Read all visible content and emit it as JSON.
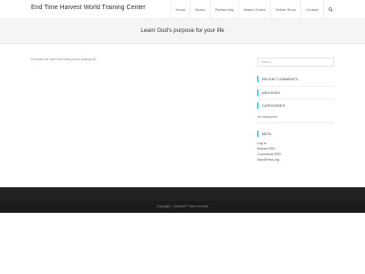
{
  "site": {
    "title": "End Time Harvest World Training Center"
  },
  "nav": {
    "items": [
      "Home",
      "Music",
      "Partnership",
      "Watch Online",
      "Online Store",
      "Contact"
    ],
    "search_icon": "search-icon"
  },
  "banner": {
    "title": "Learn God's purpose for your life"
  },
  "main": {
    "message": "It seems we can't find what you're looking for."
  },
  "sidebar": {
    "search_placeholder": "Search",
    "recent_comments": "RECENT COMMENTS",
    "archives": "ARCHIVES",
    "categories": "CATEGORIES",
    "no_categories": "No categories",
    "meta": "META",
    "meta_links": [
      "Log in",
      "Entries RSS",
      "Comments RSS",
      "WordPress.org"
    ]
  },
  "footer": {
    "copyright": "Copyright - OceanWP Theme by Nick"
  },
  "colors": {
    "accent": "#13aff0",
    "footer_dark": "#222222",
    "footer_bottom": "#1b1b1b"
  }
}
